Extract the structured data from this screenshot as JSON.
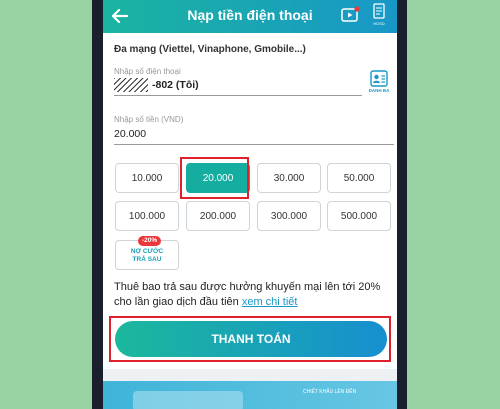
{
  "header": {
    "title": "Nạp tiền điện thoại",
    "guide_label": "HDSD"
  },
  "phone": {
    "network_label": "Đa mạng (Viettel, Vinaphone, Gmobile...)",
    "placeholder": "Nhập số điện thoại",
    "value": "-802 (Tôi)",
    "contacts_label": "DANH BẠ"
  },
  "amount": {
    "placeholder": "Nhập số tiền (VND)",
    "value": "20.000"
  },
  "denominations": [
    "10.000",
    "20.000",
    "30.000",
    "50.000",
    "100.000",
    "200.000",
    "300.000",
    "500.000"
  ],
  "selected_denomination": "20.000",
  "postpaid": {
    "badge": "-20%",
    "label_line1": "NỢ CƯỚC",
    "label_line2": "TRẢ SAU"
  },
  "promo": {
    "text": "Thuê bao trả sau được hưởng khuyến mại lên tới 20% cho lần giao dịch đầu tiên ",
    "link": "xem chi tiết"
  },
  "pay_button": "THANH TOÁN",
  "banner_text": "CHIẾT KHẤU LÊN ĐẾN",
  "colors": {
    "accent": "#14ad9f",
    "header_start": "#1bb4a0",
    "header_end": "#1897c7",
    "highlight": "#e0202a"
  }
}
